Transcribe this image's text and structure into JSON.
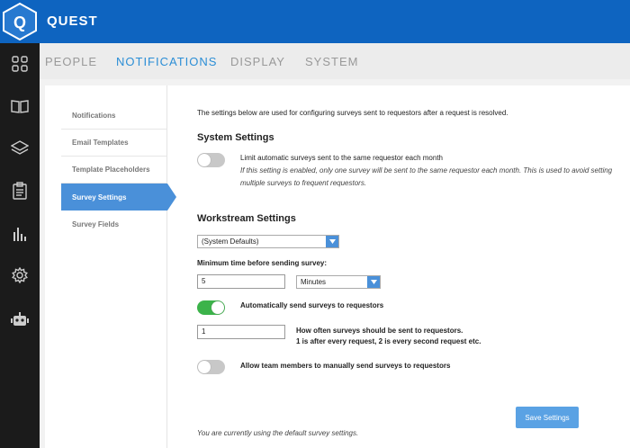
{
  "app": {
    "logo_letter": "Q",
    "title": "QUEST"
  },
  "sidebar": {
    "icons": [
      "dashboard-icon",
      "book-icon",
      "layers-icon",
      "clipboard-icon",
      "bar-chart-icon",
      "gear-icon",
      "robot-icon"
    ]
  },
  "tabs": [
    {
      "label": "PEOPLE",
      "active": false
    },
    {
      "label": "NOTIFICATIONS",
      "active": true
    },
    {
      "label": "DISPLAY",
      "active": false
    },
    {
      "label": "SYSTEM",
      "active": false
    }
  ],
  "subnav": [
    {
      "label": "Notifications",
      "active": false
    },
    {
      "label": "Email Templates",
      "active": false
    },
    {
      "label": "Template Placeholders",
      "active": false
    },
    {
      "label": "Survey Settings",
      "active": true
    },
    {
      "label": "Survey Fields",
      "active": false
    }
  ],
  "main": {
    "intro": "The settings below are used for configuring surveys sent to requestors after a request is resolved.",
    "system_heading": "System Settings",
    "limit_label": "Limit automatic surveys sent to the same requestor each month",
    "limit_enabled": false,
    "limit_help": "If this setting is enabled, only one survey will be sent to the same requestor each month. This is used to avoid setting multiple surveys to frequent requestors.",
    "workstream_heading": "Workstream Settings",
    "workstream_select": "(System Defaults)",
    "min_time_label": "Minimum time before sending survey:",
    "min_time_value": "5",
    "min_time_unit": "Minutes",
    "auto_send_label": "Automatically send surveys to requestors",
    "auto_send_enabled": true,
    "frequency_value": "1",
    "frequency_help_1": "How often surveys should be sent to requestors.",
    "frequency_help_2": "1 is after every request, 2 is every second request etc.",
    "manual_label": "Allow team members to manually send surveys to requestors",
    "manual_enabled": false,
    "save_label": "Save Settings",
    "footer_note": "You are currently using the default survey settings."
  },
  "colors": {
    "brand": "#0e64c0",
    "accent": "#4a90d9",
    "toggle_on": "#3cb34a",
    "sidebar": "#1b1b1b"
  }
}
